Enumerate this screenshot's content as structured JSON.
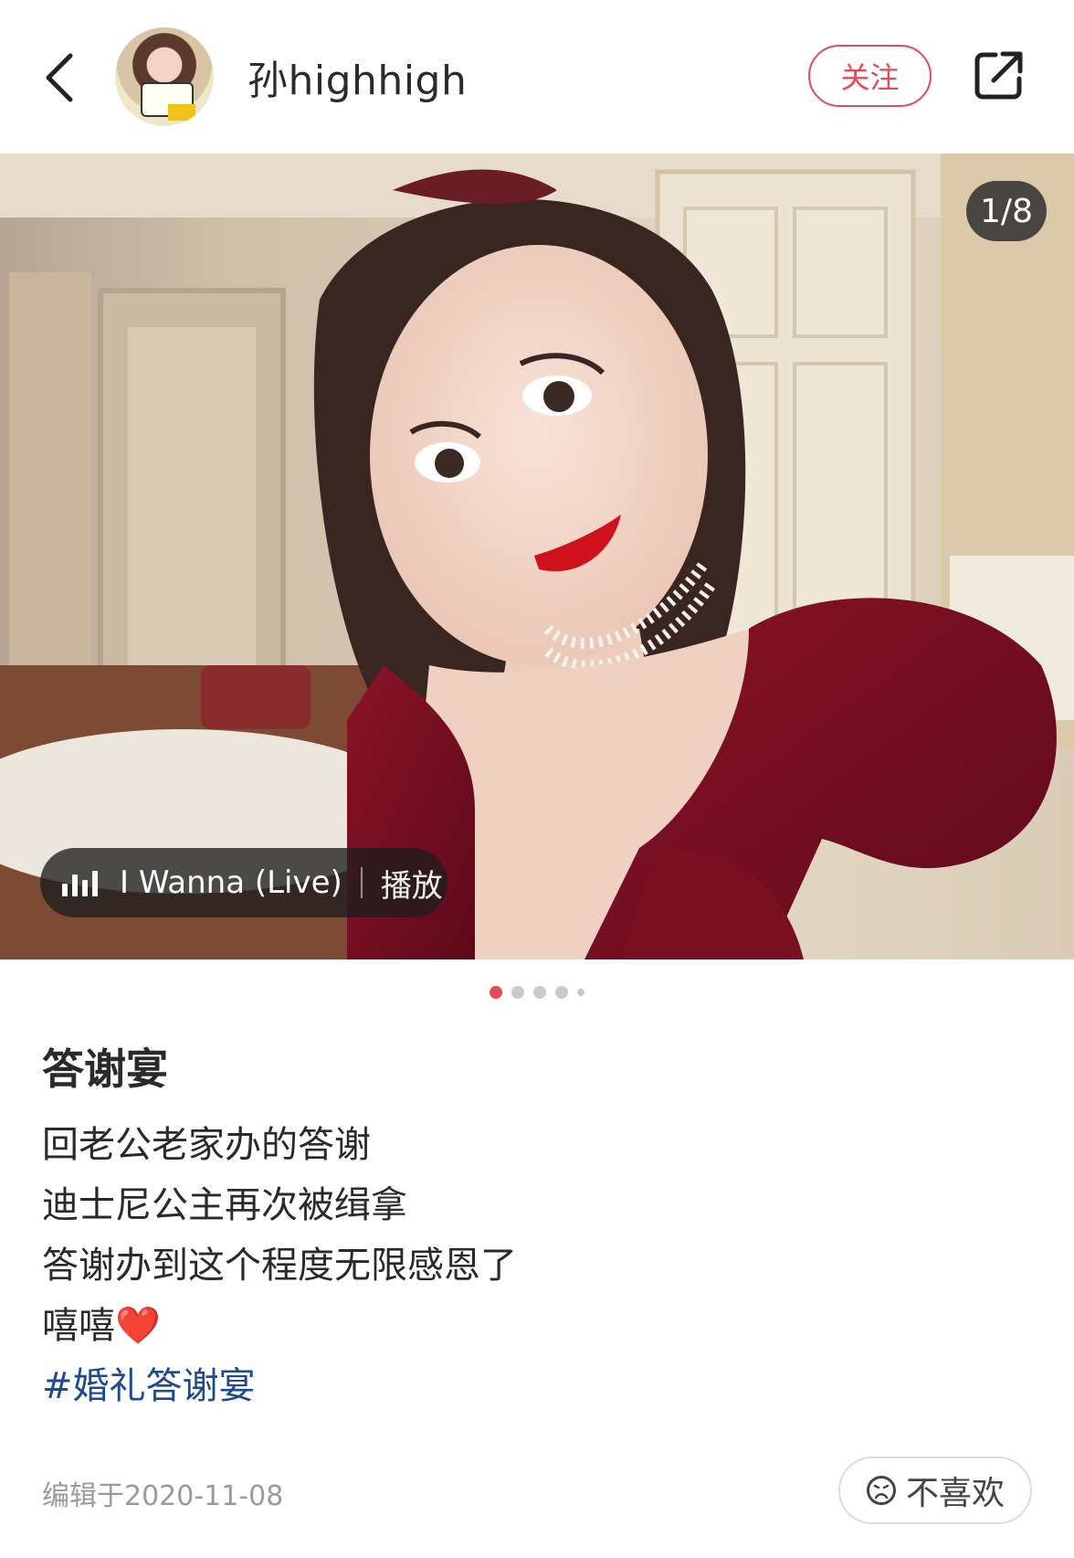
{
  "header": {
    "username": "孙highhigh",
    "follow_label": "关注"
  },
  "photo": {
    "counter": "1/8",
    "music": {
      "title": "I Wanna (Live)",
      "play_label": "播放"
    },
    "dots_active": 0
  },
  "post": {
    "title": "答谢宴",
    "lines": [
      "回老公老家办的答谢",
      "迪士尼公主再次被缉拿",
      "答谢办到这个程度无限感恩了",
      "嘻嘻"
    ],
    "heart_emoji": "❤️",
    "hashtag": "#婚礼答谢宴"
  },
  "footer": {
    "edit_date": "编辑于2020-11-08",
    "dislike_label": "不喜欢"
  },
  "colors": {
    "accent": "#e8485a",
    "hashtag": "#1e4b8f"
  }
}
